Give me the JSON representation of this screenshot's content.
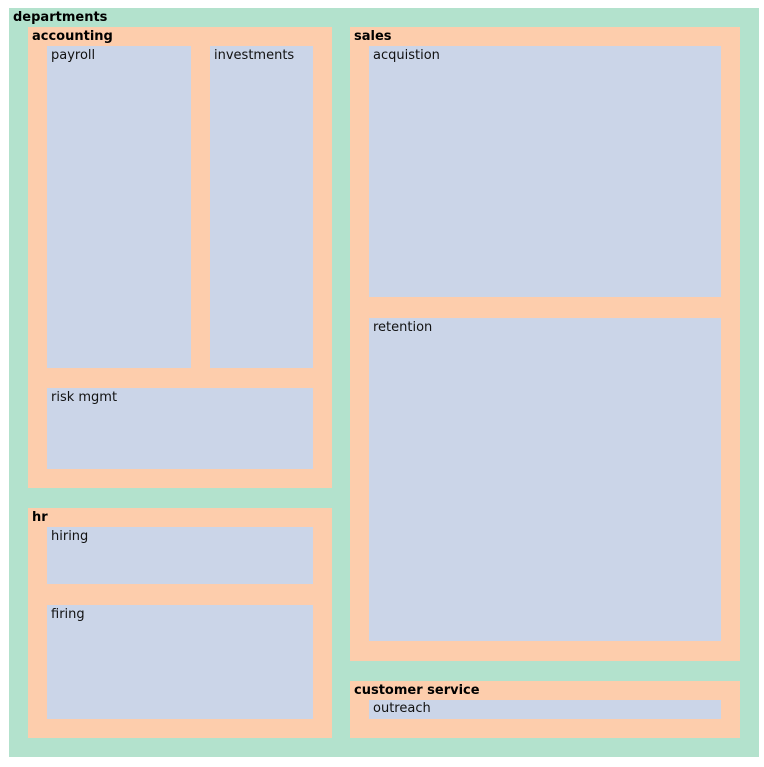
{
  "colors": {
    "root_fill": "#b3e2cd",
    "group_fill": "#fdcdac",
    "leaf_fill": "#cbd5e8"
  },
  "treemap": {
    "root": "departments",
    "groups": {
      "accounting": {
        "label": "accounting",
        "leaves": {
          "payroll": "payroll",
          "investments": "investments",
          "risk_mgmt": "risk mgmt"
        }
      },
      "hr": {
        "label": "hr",
        "leaves": {
          "hiring": "hiring",
          "firing": "firing"
        }
      },
      "sales": {
        "label": "sales",
        "leaves": {
          "acquisition": "acquistion",
          "retention": "retention"
        }
      },
      "customer_service": {
        "label": "customer service",
        "leaves": {
          "outreach": "outreach"
        }
      }
    }
  }
}
